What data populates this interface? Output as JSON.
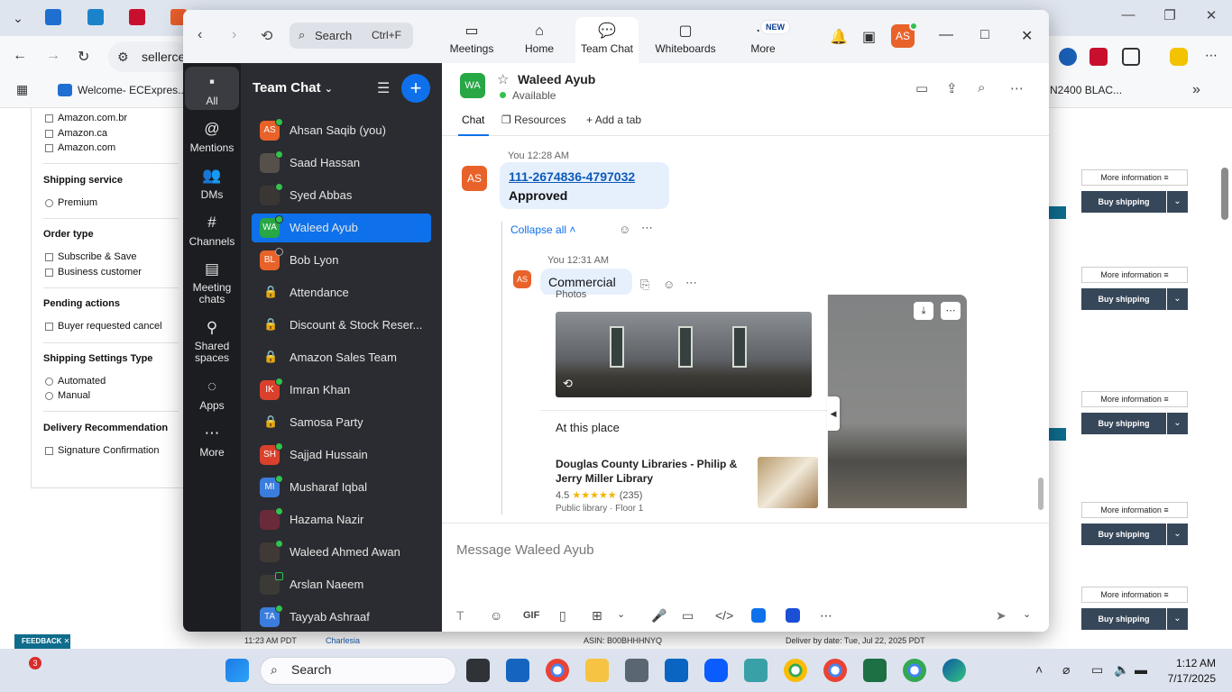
{
  "browser": {
    "favorites": [
      "Welcome- ECExpres..."
    ],
    "address_text": "sellerce",
    "fav_right": "N2400 BLAC..."
  },
  "seller_panel": {
    "marketplaces": [
      "Amazon.com.br",
      "Amazon.ca",
      "Amazon.com"
    ],
    "sections": [
      {
        "title": "Shipping service",
        "options": [
          "Premium"
        ]
      },
      {
        "title": "Order type",
        "options": [
          "Subscribe & Save",
          "Business customer"
        ]
      },
      {
        "title": "Pending actions",
        "options": [
          "Buyer requested cancel"
        ]
      },
      {
        "title": "Shipping Settings Type",
        "options": [
          "Automated",
          "Manual"
        ]
      },
      {
        "title": "Delivery Recommendation",
        "options": [
          "Signature Confirmation"
        ]
      }
    ],
    "more_info_label": "More information",
    "buy_shipping_label": "Buy shipping",
    "feedback_label": "FEEDBACK",
    "bottom_time": "11:23 AM PDT",
    "bottom_name": "Charlesia",
    "bottom_asin": "ASIN: B00BHHHNYQ",
    "bottom_deliver": "Deliver by date: Tue, Jul 22, 2025 PDT"
  },
  "zoom": {
    "search": {
      "label": "Search",
      "shortcut": "Ctrl+F"
    },
    "tabs": [
      {
        "label": "Meetings",
        "icon": "video-icon"
      },
      {
        "label": "Home",
        "icon": "home-icon"
      },
      {
        "label": "Team Chat",
        "icon": "chat-icon"
      },
      {
        "label": "Whiteboards",
        "icon": "whiteboard-icon"
      },
      {
        "label": "More",
        "icon": "more-icon"
      }
    ],
    "new_badge": "NEW",
    "user_initials": "AS",
    "rail": [
      {
        "label": "All",
        "icon": "chat-bubble-icon"
      },
      {
        "label": "Mentions",
        "icon": "at-icon"
      },
      {
        "label": "DMs",
        "icon": "people-icon"
      },
      {
        "label": "Channels",
        "icon": "hash-icon"
      },
      {
        "label": "Meeting chats",
        "icon": "calendar-icon"
      },
      {
        "label": "Shared spaces",
        "icon": "share-icon"
      },
      {
        "label": "Apps",
        "icon": "apps-icon"
      },
      {
        "label": "More",
        "icon": "ellipsis-icon"
      }
    ],
    "list_title": "Team Chat",
    "contacts": [
      {
        "name": "Ahsan Saqib (you)",
        "initials": "AS",
        "color": "#e8622a",
        "status": "online"
      },
      {
        "name": "Saad Hassan",
        "initials": "",
        "color": "#55504a",
        "status": "online"
      },
      {
        "name": "Syed Abbas",
        "initials": "",
        "color": "#3a3633",
        "status": "online"
      },
      {
        "name": "Waleed Ayub",
        "initials": "WA",
        "color": "#28a745",
        "status": "online"
      },
      {
        "name": "Bob Lyon",
        "initials": "BL",
        "color": "#e8622a",
        "status": "offline"
      },
      {
        "name": "Attendance",
        "initials": "",
        "color": "",
        "status": "channel"
      },
      {
        "name": "Discount & Stock Reser...",
        "initials": "",
        "color": "",
        "status": "channel"
      },
      {
        "name": "Amazon Sales Team",
        "initials": "",
        "color": "",
        "status": "channel"
      },
      {
        "name": "Imran Khan",
        "initials": "IK",
        "color": "#d9412c",
        "status": "online"
      },
      {
        "name": "Samosa Party",
        "initials": "",
        "color": "",
        "status": "channel"
      },
      {
        "name": "Sajjad Hussain",
        "initials": "SH",
        "color": "#d9412c",
        "status": "online"
      },
      {
        "name": "Musharaf Iqbal",
        "initials": "MI",
        "color": "#3b7ddd",
        "status": "online"
      },
      {
        "name": "Hazama Nazir",
        "initials": "",
        "color": "#6a2a3a",
        "status": "online"
      },
      {
        "name": "Waleed Ahmed Awan",
        "initials": "",
        "color": "#403a36",
        "status": "online"
      },
      {
        "name": "Arslan Naeem",
        "initials": "",
        "color": "#3c3a37",
        "status": "mobile"
      },
      {
        "name": "Tayyab Ashraaf",
        "initials": "TA",
        "color": "#3b7ddd",
        "status": "online"
      }
    ],
    "chat": {
      "contact_name": "Waleed Ayub",
      "contact_initials": "WA",
      "status": "Available",
      "tabs": [
        "Chat",
        "Resources",
        "Add a tab"
      ],
      "msg1": {
        "meta": "You 12:28 AM",
        "avatar": "AS",
        "link": "111-2674836-4797032",
        "text": "Approved"
      },
      "collapse_label": "Collapse all",
      "msg2": {
        "meta": "You 12:31 AM",
        "avatar": "AS",
        "text": "Commercial"
      },
      "card": {
        "photos_label": "Photos",
        "place_label": "At this place",
        "library_name": "Douglas County Libraries - Philip & Jerry Miller Library",
        "rating": "4.5",
        "stars": "★★★★★",
        "reviews": "(235)",
        "subtitle": "Public library · Floor 1"
      },
      "input_placeholder": "Message Waleed Ayub",
      "gif_label": "GIF"
    }
  },
  "taskbar": {
    "search_label": "Search",
    "time": "1:12 AM",
    "date": "7/17/2025",
    "notification_count": "3"
  }
}
